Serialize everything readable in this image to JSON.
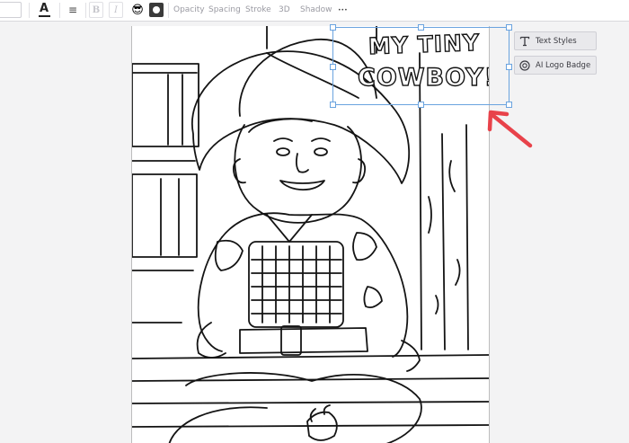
{
  "toolbar": {
    "align_glyph": "≡",
    "bold_glyph": "B",
    "italic_glyph": "I",
    "emoji_glyph": "😎",
    "opacity_label": "Opacity",
    "spacing_label": "Spacing",
    "stroke_label": "Stroke",
    "threed_label": "3D",
    "shadow_label": "Shadow",
    "more_glyph": "•••",
    "text_color_glyph": "A"
  },
  "side_panel": {
    "text_styles_label": "Text Styles",
    "ai_logo_badge_label": "AI Logo Badge"
  },
  "canvas": {
    "title_line1": "MY TINY",
    "title_line2": "COWBOY!"
  },
  "colors": {
    "selection": "#6aa3df",
    "arrow": "#e8424a",
    "toolbar_text": "#9a9aa2",
    "line_art": "#141414"
  }
}
